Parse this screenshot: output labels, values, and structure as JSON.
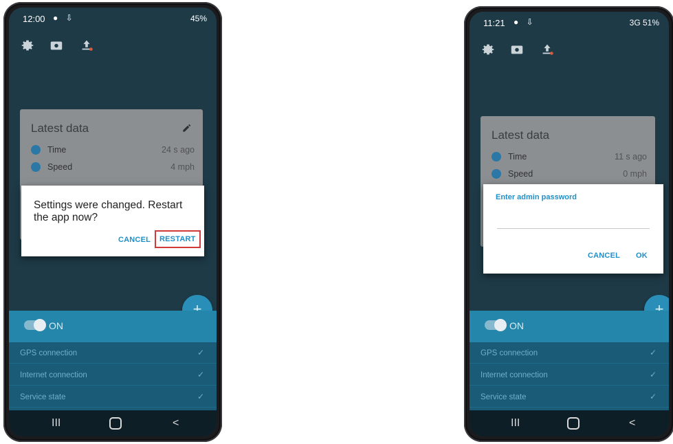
{
  "left_phone": {
    "status": {
      "time": "12:00",
      "right": "45%"
    },
    "card": {
      "title": "Latest data",
      "rows": [
        {
          "label": "Time",
          "value": "24 s ago"
        },
        {
          "label": "Speed",
          "value": "4 mph"
        }
      ]
    },
    "dialog": {
      "message": "Settings were changed. Restart the app now?",
      "cancel": "CANCEL",
      "confirm": "RESTART"
    },
    "fab": "+",
    "service_toggle": "ON",
    "status_items": [
      {
        "label": "GPS connection",
        "check": "✓"
      },
      {
        "label": "Internet connection",
        "check": "✓"
      },
      {
        "label": "Service state",
        "check": "✓"
      }
    ],
    "nav": {
      "recents": "III",
      "back": "<"
    }
  },
  "right_phone": {
    "status": {
      "time": "11:21",
      "right": "3G 51%"
    },
    "card": {
      "title": "Latest data",
      "rows": [
        {
          "label": "Time",
          "value": "11 s ago"
        },
        {
          "label": "Speed",
          "value": "0 mph"
        }
      ]
    },
    "dialog": {
      "heading": "Enter admin password",
      "password_value": "",
      "cancel": "CANCEL",
      "confirm": "OK"
    },
    "fab": "+",
    "service_toggle": "ON",
    "status_items": [
      {
        "label": "GPS connection",
        "check": "✓"
      },
      {
        "label": "Internet connection",
        "check": "✓"
      },
      {
        "label": "Service state",
        "check": "✓"
      }
    ],
    "nav": {
      "recents": "III",
      "back": "<"
    }
  },
  "colors": {
    "accent": "#1f8fc8",
    "highlight_box": "#d23a3a",
    "on_bar": "#2586ac"
  }
}
